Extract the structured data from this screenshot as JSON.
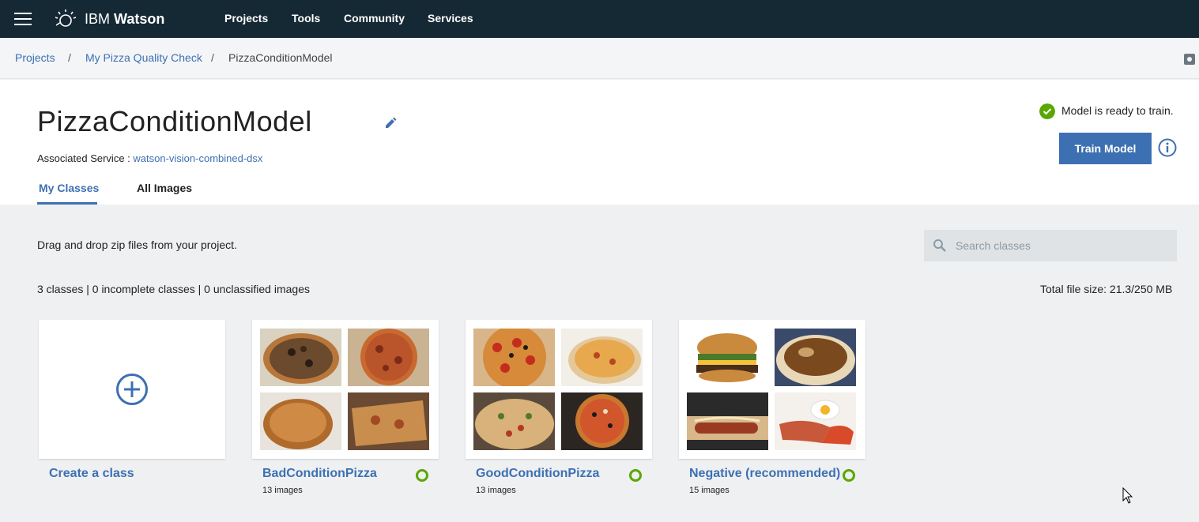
{
  "nav": {
    "brand_light": "IBM",
    "brand_bold": "Watson",
    "items": [
      "Projects",
      "Tools",
      "Community",
      "Services"
    ]
  },
  "breadcrumb": {
    "items": [
      "Projects",
      "My Pizza Quality Check",
      "PizzaConditionModel"
    ],
    "separator": "/"
  },
  "header": {
    "title": "PizzaConditionModel",
    "assoc_label": "Associated Service : ",
    "assoc_value": "watson-vision-combined-dsx",
    "status_text": "Model is ready to train.",
    "train_button": "Train Model",
    "tabs": [
      "My Classes",
      "All Images"
    ]
  },
  "main": {
    "drag_text": "Drag and drop zip files from your project.",
    "search_placeholder": "Search classes",
    "counts_text": "3 classes | 0 incomplete classes | 0 unclassified images",
    "filesize_text": "Total file size: 21.3/250 MB",
    "create_label": "Create a class",
    "classes": [
      {
        "name": "BadConditionPizza",
        "count": "13 images"
      },
      {
        "name": "GoodConditionPizza",
        "count": "13 images"
      },
      {
        "name": "Negative (recommended)",
        "count": "15 images"
      }
    ]
  },
  "colors": {
    "topbar": "#152935",
    "accent": "#3d70b2",
    "ready": "#5aa700"
  },
  "icons": [
    "menu-icon",
    "watson-logo-icon",
    "settings-icon",
    "edit-pencil-icon",
    "check-circle-icon",
    "info-icon",
    "search-icon",
    "add-circle-icon",
    "status-ring-icon",
    "mouse-cursor-icon"
  ]
}
